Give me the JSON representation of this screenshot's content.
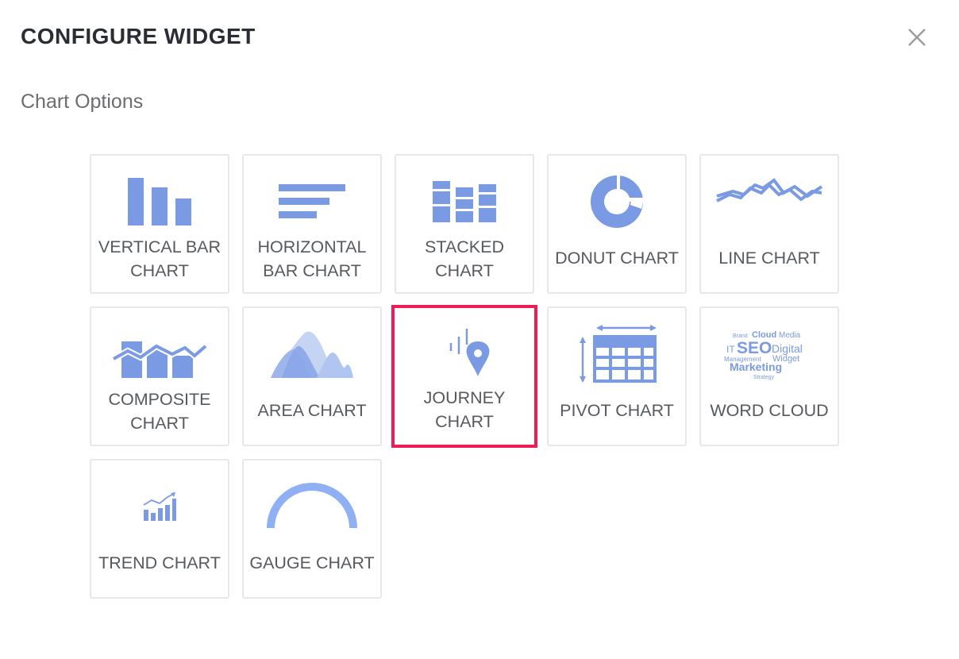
{
  "modal": {
    "title": "CONFIGURE WIDGET",
    "section_label": "Chart Options"
  },
  "tiles": [
    {
      "label": "VERTICAL BAR CHART",
      "icon": "vertical-bar-chart-icon"
    },
    {
      "label": "HORIZONTAL BAR CHART",
      "icon": "horizontal-bar-chart-icon"
    },
    {
      "label": "STACKED CHART",
      "icon": "stacked-chart-icon"
    },
    {
      "label": "DONUT CHART",
      "icon": "donut-chart-icon"
    },
    {
      "label": "LINE CHART",
      "icon": "line-chart-icon"
    },
    {
      "label": "COMPOSITE CHART",
      "icon": "composite-chart-icon"
    },
    {
      "label": "AREA CHART",
      "icon": "area-chart-icon"
    },
    {
      "label": "JOURNEY CHART",
      "icon": "journey-chart-icon",
      "selected": true
    },
    {
      "label": "PIVOT CHART",
      "icon": "pivot-chart-icon"
    },
    {
      "label": "WORD CLOUD",
      "icon": "word-cloud-icon"
    },
    {
      "label": "TREND CHART",
      "icon": "trend-chart-icon"
    },
    {
      "label": "GAUGE CHART",
      "icon": "gauge-chart-icon"
    }
  ],
  "word_cloud_words": [
    "Brand",
    "Cloud",
    "Media",
    "IT",
    "SEO",
    "Digital",
    "Management",
    "Widget",
    "Marketing",
    "Strategy"
  ],
  "colors": {
    "icon": "#7a9be3",
    "icon_light": "#a9bff0",
    "selected_border": "#ee1c57",
    "tile_border": "#e7e8ea"
  }
}
